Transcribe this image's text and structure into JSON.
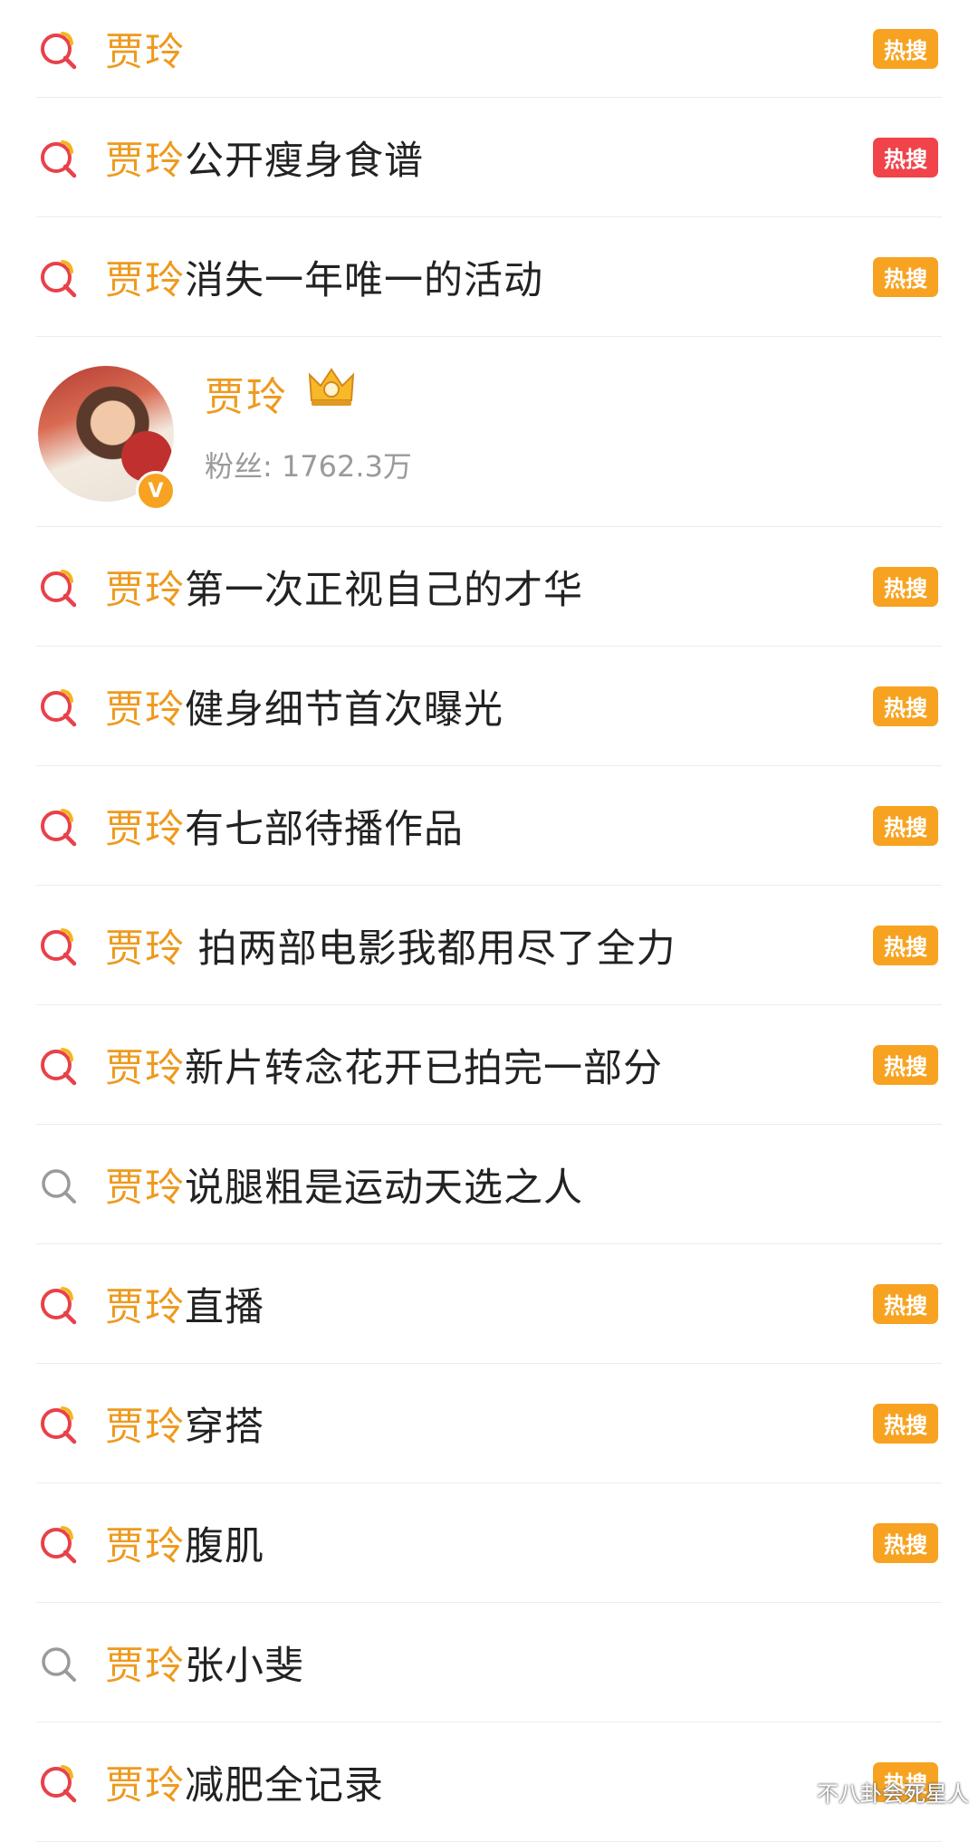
{
  "keyword": "贾玲",
  "badge_label": "热搜",
  "rows_top": [
    {
      "suffix": "",
      "badge": true,
      "badge_color": "orange",
      "icon": "hot-search-icon"
    },
    {
      "suffix": "公开瘦身食谱",
      "badge": true,
      "badge_color": "red",
      "icon": "hot-search-icon"
    },
    {
      "suffix": "消失一年唯一的活动",
      "badge": true,
      "badge_color": "orange",
      "icon": "hot-search-icon"
    }
  ],
  "user": {
    "name": "贾玲",
    "fans_label": "粉丝: 1762.3万",
    "verified_mark": "V",
    "crown_icon": "vip-crown-icon"
  },
  "rows_bottom": [
    {
      "suffix": "第一次正视自己的才华",
      "badge": true,
      "badge_color": "orange",
      "icon": "hot-search-icon"
    },
    {
      "suffix": "健身细节首次曝光",
      "badge": true,
      "badge_color": "orange",
      "icon": "hot-search-icon"
    },
    {
      "suffix": "有七部待播作品",
      "badge": true,
      "badge_color": "orange",
      "icon": "hot-search-icon"
    },
    {
      "suffix": " 拍两部电影我都用尽了全力",
      "badge": true,
      "badge_color": "orange",
      "icon": "hot-search-icon"
    },
    {
      "suffix": "新片转念花开已拍完一部分",
      "badge": true,
      "badge_color": "orange",
      "icon": "hot-search-icon"
    },
    {
      "suffix": "说腿粗是运动天选之人",
      "badge": false,
      "badge_color": "",
      "icon": "search-icon"
    },
    {
      "suffix": "直播",
      "badge": true,
      "badge_color": "orange",
      "icon": "hot-search-icon"
    },
    {
      "suffix": "穿搭",
      "badge": true,
      "badge_color": "orange",
      "icon": "hot-search-icon"
    },
    {
      "suffix": "腹肌",
      "badge": true,
      "badge_color": "orange",
      "icon": "hot-search-icon"
    },
    {
      "suffix": "张小斐",
      "badge": false,
      "badge_color": "",
      "icon": "search-icon"
    },
    {
      "suffix": "减肥全记录",
      "badge": true,
      "badge_color": "orange",
      "icon": "hot-search-icon"
    }
  ],
  "colors": {
    "keyword": "#ee9a1e",
    "badge_orange": "#f7a321",
    "badge_red": "#f0434a",
    "hot_icon": "#e8414a"
  },
  "watermark": "不八卦会死星人"
}
